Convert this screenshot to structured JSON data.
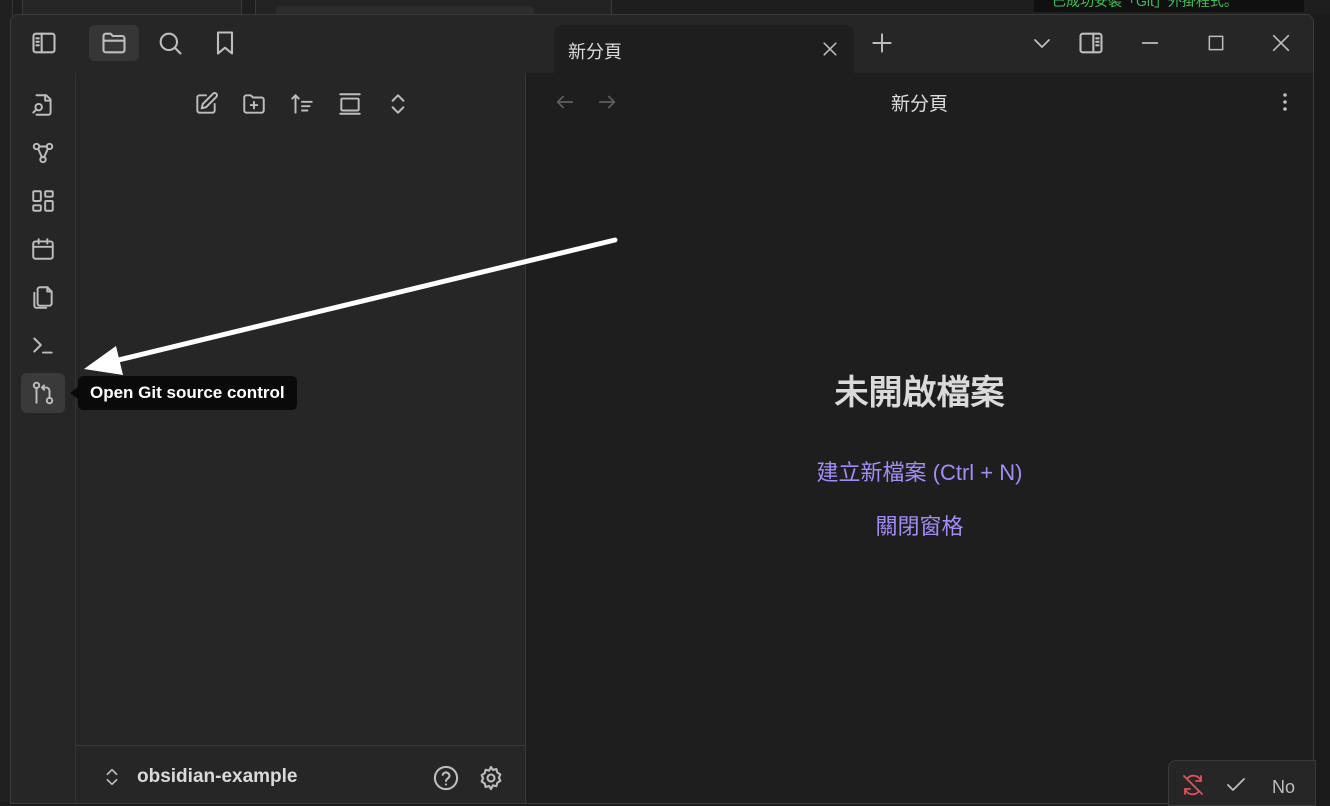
{
  "notification": {
    "text": "已成功安裝「Git」外掛程式。"
  },
  "titlebar": {
    "tab_label": "新分頁",
    "icons": [
      "sidebar-toggle-icon",
      "folder-icon",
      "search-icon",
      "bookmark-icon",
      "close-icon",
      "plus-icon",
      "chevron-down-icon",
      "right-sidebar-icon",
      "minimize-icon",
      "maximize-icon",
      "close-window-icon"
    ]
  },
  "ribbon": {
    "items": [
      "switcher-icon",
      "graph-icon",
      "canvas-icon",
      "calendar-icon",
      "templates-icon",
      "terminal-icon",
      "git-source-control-icon"
    ]
  },
  "tooltip": {
    "text": "Open Git source control"
  },
  "sidebar": {
    "nav_icons": [
      "new-note-icon",
      "new-folder-icon",
      "sort-icon",
      "collapse-icon",
      "expand-icon"
    ],
    "vault_name": "obsidian-example"
  },
  "editor": {
    "view_title": "新分頁",
    "empty_title": "未開啟檔案",
    "create_link": "建立新檔案 (Ctrl + N)",
    "close_link": "關閉窗格"
  },
  "statusbar": {
    "text": "No"
  },
  "colors": {
    "accent": "#a48cf5",
    "background": "#1e1e1e",
    "panel": "#262626",
    "tooltip": "#0a0a0a",
    "notice": "#3fbf5a",
    "alert": "#e0525a"
  }
}
